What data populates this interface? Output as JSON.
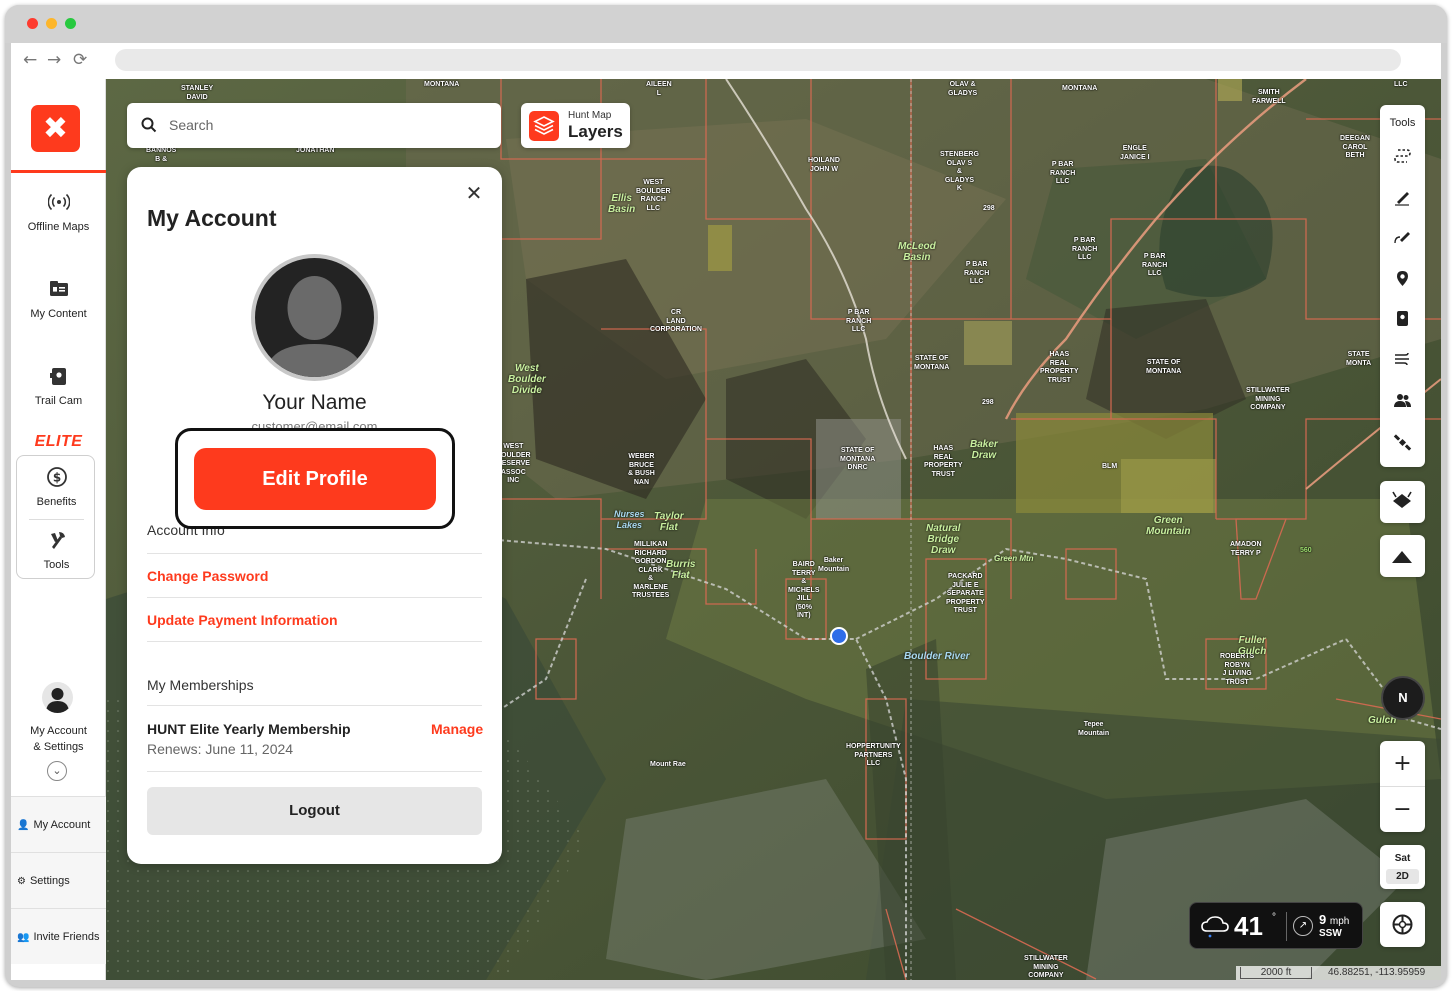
{
  "sidebar": {
    "offline_maps": "Offline Maps",
    "my_content": "My Content",
    "trail_cam": "Trail Cam",
    "elite": "ELITE",
    "benefits": "Benefits",
    "tools": "Tools",
    "account_line1": "My Account",
    "account_line2": "& Settings",
    "bottom_my_account": "My Account",
    "bottom_settings": "Settings",
    "bottom_invite": "Invite Friends"
  },
  "search": {
    "placeholder": "Search"
  },
  "layers": {
    "line1": "Hunt Map",
    "line2": "Layers"
  },
  "account_panel": {
    "title": "My Account",
    "name": "Your Name",
    "email": "customer@email.com",
    "edit_profile": "Edit Profile",
    "account_info": "Account Info",
    "change_password": "Change Password",
    "update_payment": "Update Payment Information",
    "memberships_heading": "My Memberships",
    "membership_name": "HUNT Elite Yearly Membership",
    "membership_renews": "Renews: June 11, 2024",
    "manage": "Manage",
    "logout": "Logout"
  },
  "map_tools": {
    "label": "Tools"
  },
  "compass": {
    "label": "N"
  },
  "zoom": {
    "in": "+",
    "out": "−"
  },
  "basemap": {
    "type": "Sat",
    "mode": "2D"
  },
  "weather": {
    "temp": "41",
    "deg": "°",
    "wind_speed": "9",
    "wind_unit": "mph",
    "wind_dir": "SSW"
  },
  "scale": {
    "distance": "2000 ft",
    "coords": "46.88251, -113.95959"
  },
  "map_labels": [
    "STANLEY\nDAVID",
    "MONTANA",
    "AILEEN\nL",
    "OLAV &\nGLADYS",
    "MONTANA",
    "SMITH\nFARWELL",
    "LLC",
    "BANNOS\nB &",
    "JONATHAN",
    "DEEGAN\nCAROL\nBETH",
    "HOILAND\nJOHN W",
    "STENBERG\nOLAV S\n&\nGLADYS\nK",
    "P BAR\nRANCH\nLLC",
    "ENGLE\nJANICE I",
    "WEST\nBOULDER\nRANCH\nLLC",
    "P BAR\nRANCH\nLLC",
    "P BAR\nRANCH\nLLC",
    "P BAR\nRANCH\nLLC",
    "CR\nLAND\nCORPORATION",
    "P BAR\nRANCH\nLLC",
    "STATE OF\nMONTANA",
    "HAAS\nREAL\nPROPERTY\nTRUST",
    "STATE OF\nMONTANA",
    "STILLWATER\nMINING\nCOMPANY",
    "STATE\nMONTA",
    "WEST\nBOULDER\nRESERVE\nASSOC\nINC",
    "WEBER\nBRUCE\n& BUSH\nNAN",
    "STATE OF\nMONTANA\nDNRC",
    "HAAS\nREAL\nPROPERTY\nTRUST",
    "BLM",
    "AMADON\nTERRY P",
    "MILLIKAN\nRICHARD\nGORDON\nCLARK\n&\nMARLENE\nTRUSTEES",
    "BAIRD\nTERRY\n&\nMICHELS\nJILL\n(50%\nINT)",
    "PACKARD\nJULIE E\nSEPARATE\nPROPERTY\nTRUST",
    "ROBERTS\nROBYN\nJ LIVING\nTRUST",
    "HOPPERTUNITY\nPARTNERS\nLLC",
    "STILLWATER\nMINING\nCOMPANY",
    "Baker\nMountain",
    "Tepee\nMountain",
    "Mount Rae",
    "560",
    "298",
    "298"
  ],
  "map_place_labels": [
    "Ellis\nBasin",
    "McLeod\nBasin",
    "West\nBoulder\nDivide",
    "Baker\nDraw",
    "Green\nMountain",
    "Taylor\nFlat",
    "Nurses\nLakes",
    "Natural\nBridge\nDraw",
    "Burris\nFlat",
    "Boulder River",
    "Green Mtn",
    "Fuller\nGulch",
    "Gulch"
  ],
  "colors": {
    "brand": "#fe3a1d",
    "boundary": "#d86a52",
    "dark_ui": "#111111"
  }
}
